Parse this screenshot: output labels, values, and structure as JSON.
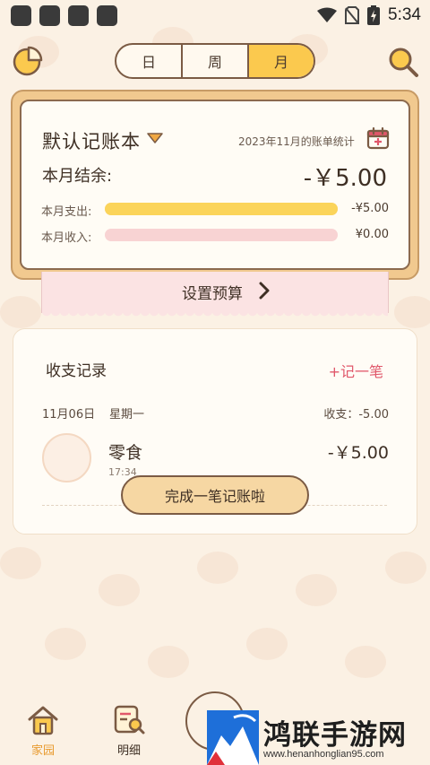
{
  "status_bar": {
    "time": "5:34"
  },
  "header": {
    "period_tabs": [
      {
        "label": "日",
        "active": false
      },
      {
        "label": "周",
        "active": false
      },
      {
        "label": "月",
        "active": true
      }
    ],
    "left_icon": "pie-chart-icon",
    "right_icon": "search-icon"
  },
  "account_card": {
    "book_name": "默认记账本",
    "stat_label": "2023年11月的账单统计",
    "balance_label": "本月结余:",
    "balance_value": "-￥5.00",
    "expense": {
      "label": "本月支出:",
      "value": "-¥5.00",
      "fill": 1.0,
      "color": "#FBD45A"
    },
    "income": {
      "label": "本月收入:",
      "value": "¥0.00",
      "fill": 0.0,
      "color": "#F8D3D3"
    },
    "budget_label": "设置预算"
  },
  "records": {
    "title": "收支记录",
    "add_label": "+记一笔",
    "day": {
      "date": "11月06日",
      "weekday": "星期一",
      "total": "收支：-5.00"
    },
    "entries": [
      {
        "name": "零食",
        "time": "17:34",
        "amount": "-￥5.00"
      }
    ]
  },
  "toast": {
    "text": "完成一笔记账啦"
  },
  "bottom_nav": {
    "items": [
      {
        "label": "家园",
        "active": true
      },
      {
        "label": "明细",
        "active": false
      }
    ]
  },
  "watermark": {
    "title": "鸿联手游网",
    "url": "www.henanhonglian95.com"
  },
  "colors": {
    "accent": "#FBC94E",
    "brand_border": "#7B5B44",
    "add_red": "#E0576A",
    "background": "#FBF1E4"
  }
}
